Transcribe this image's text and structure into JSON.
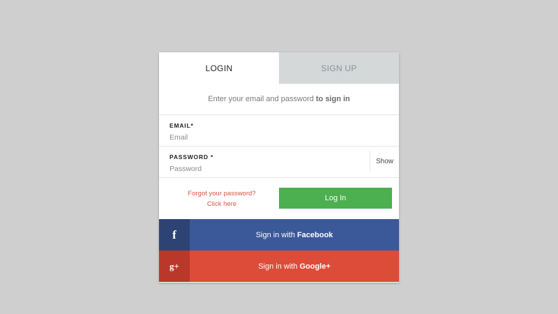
{
  "tabs": {
    "login": "LOGIN",
    "signup": "SIGN UP"
  },
  "subtitle": {
    "prefix": "Enter your email and password",
    "emphasis": "to sign in"
  },
  "email": {
    "label": "EMAIL*",
    "placeholder": "Email",
    "value": ""
  },
  "password": {
    "label": "PASSWORD *",
    "placeholder": "Password",
    "value": "",
    "show_label": "Show"
  },
  "forgot": {
    "line1": "Forgot your password?",
    "line2": "Click here"
  },
  "login_button": "Log In",
  "facebook": {
    "icon": "f",
    "prefix": "Sign in with",
    "brand": "Facebook"
  },
  "google": {
    "icon": "g+",
    "prefix": "Sign in with",
    "brand": "Google+"
  },
  "colors": {
    "background": "#cfcfcf",
    "login_green": "#4caf50",
    "link_red": "#d9533f",
    "facebook_blue": "#3b5998",
    "google_red": "#dd4b39"
  }
}
